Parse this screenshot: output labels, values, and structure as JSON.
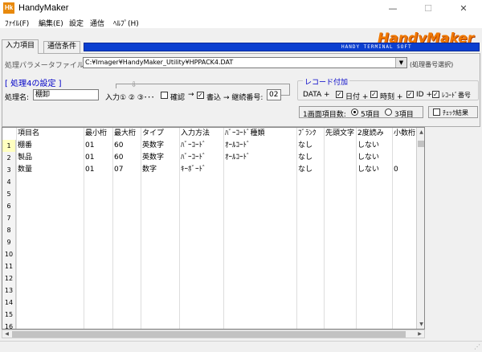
{
  "window": {
    "title": "HandyMaker",
    "icon_text": "Hk",
    "minimize": "—",
    "maximize": "☐",
    "close": "✕"
  },
  "menu": [
    {
      "label": "ﾌｧｲﾙ(F)"
    },
    {
      "label": "編集(E)"
    },
    {
      "label": "設定"
    },
    {
      "label": "通信"
    },
    {
      "label": "ﾍﾙﾌﾟ(H)"
    }
  ],
  "tabs": [
    {
      "label": "入力項目",
      "active": true
    },
    {
      "label": "通信条件",
      "active": false
    }
  ],
  "banner": {
    "text": "HANDY TERMINAL SOFT",
    "logo": "HandyMaker",
    "color": "#0a3fd0",
    "logo_color": "#f07800"
  },
  "file": {
    "label": "処理パラメータファイル:",
    "value": "C:¥Imager¥HandyMaker_Utility¥HPPACK4.DAT",
    "hint": "(処理番号選択)"
  },
  "process": {
    "title": "[ 処理4の設定 ]",
    "name_label": "処理名:",
    "name_value": "棚卸",
    "input_seq": "入力① ② ③･･･",
    "confirm_label": "確認",
    "write_label": "書込",
    "seq_label": "→ 継続番号:",
    "seq_value": "02",
    "confirm_checked": false,
    "write_checked": true
  },
  "record": {
    "title": "レコード付加",
    "data_label": "DATA +",
    "date_label": "日付 +",
    "time_label": "時刻 +",
    "id_label": "ID +",
    "recno_label": "ﾚｺｰﾄﾞ番号",
    "date_checked": true,
    "time_checked": true,
    "id_checked": true,
    "recno_checked": true
  },
  "screen_items": {
    "label": "1画面項目数:",
    "opt5": "5項目",
    "opt3": "3項目",
    "selected": "5項目"
  },
  "check_result": {
    "label": "ﾁｪｯｸ結果",
    "checked": false
  },
  "grid": {
    "columns": [
      "",
      "項目名",
      "最小桁",
      "最大桁",
      "タイプ",
      "入力方法",
      "ﾊﾞｰｺｰﾄﾞ種類",
      "ﾌﾞﾗﾝｸ",
      "先頭文字",
      "2度読み",
      "小数桁"
    ],
    "rows": [
      [
        "1",
        "棚番",
        "01",
        "60",
        "英数字",
        "ﾊﾞｰｺｰﾄﾞ",
        "ｵｰﾙｺｰﾄﾞ",
        "なし",
        "",
        "しない",
        ""
      ],
      [
        "2",
        "製品",
        "01",
        "60",
        "英数字",
        "ﾊﾞｰｺｰﾄﾞ",
        "ｵｰﾙｺｰﾄﾞ",
        "なし",
        "",
        "しない",
        ""
      ],
      [
        "3",
        "数量",
        "01",
        "07",
        "数字",
        "ｷｰﾎﾞｰﾄﾞ",
        "",
        "なし",
        "",
        "しない",
        "0"
      ],
      [
        "4",
        "",
        "",
        "",
        "",
        "",
        "",
        "",
        "",
        "",
        ""
      ],
      [
        "5",
        "",
        "",
        "",
        "",
        "",
        "",
        "",
        "",
        "",
        ""
      ],
      [
        "6",
        "",
        "",
        "",
        "",
        "",
        "",
        "",
        "",
        "",
        ""
      ],
      [
        "7",
        "",
        "",
        "",
        "",
        "",
        "",
        "",
        "",
        "",
        ""
      ],
      [
        "8",
        "",
        "",
        "",
        "",
        "",
        "",
        "",
        "",
        "",
        ""
      ],
      [
        "9",
        "",
        "",
        "",
        "",
        "",
        "",
        "",
        "",
        "",
        ""
      ],
      [
        "10",
        "",
        "",
        "",
        "",
        "",
        "",
        "",
        "",
        "",
        ""
      ],
      [
        "11",
        "",
        "",
        "",
        "",
        "",
        "",
        "",
        "",
        "",
        ""
      ],
      [
        "12",
        "",
        "",
        "",
        "",
        "",
        "",
        "",
        "",
        "",
        ""
      ],
      [
        "13",
        "",
        "",
        "",
        "",
        "",
        "",
        "",
        "",
        "",
        ""
      ],
      [
        "14",
        "",
        "",
        "",
        "",
        "",
        "",
        "",
        "",
        "",
        ""
      ],
      [
        "15",
        "",
        "",
        "",
        "",
        "",
        "",
        "",
        "",
        "",
        ""
      ],
      [
        "16",
        "",
        "",
        "",
        "",
        "",
        "",
        "",
        "",
        "",
        ""
      ]
    ]
  }
}
